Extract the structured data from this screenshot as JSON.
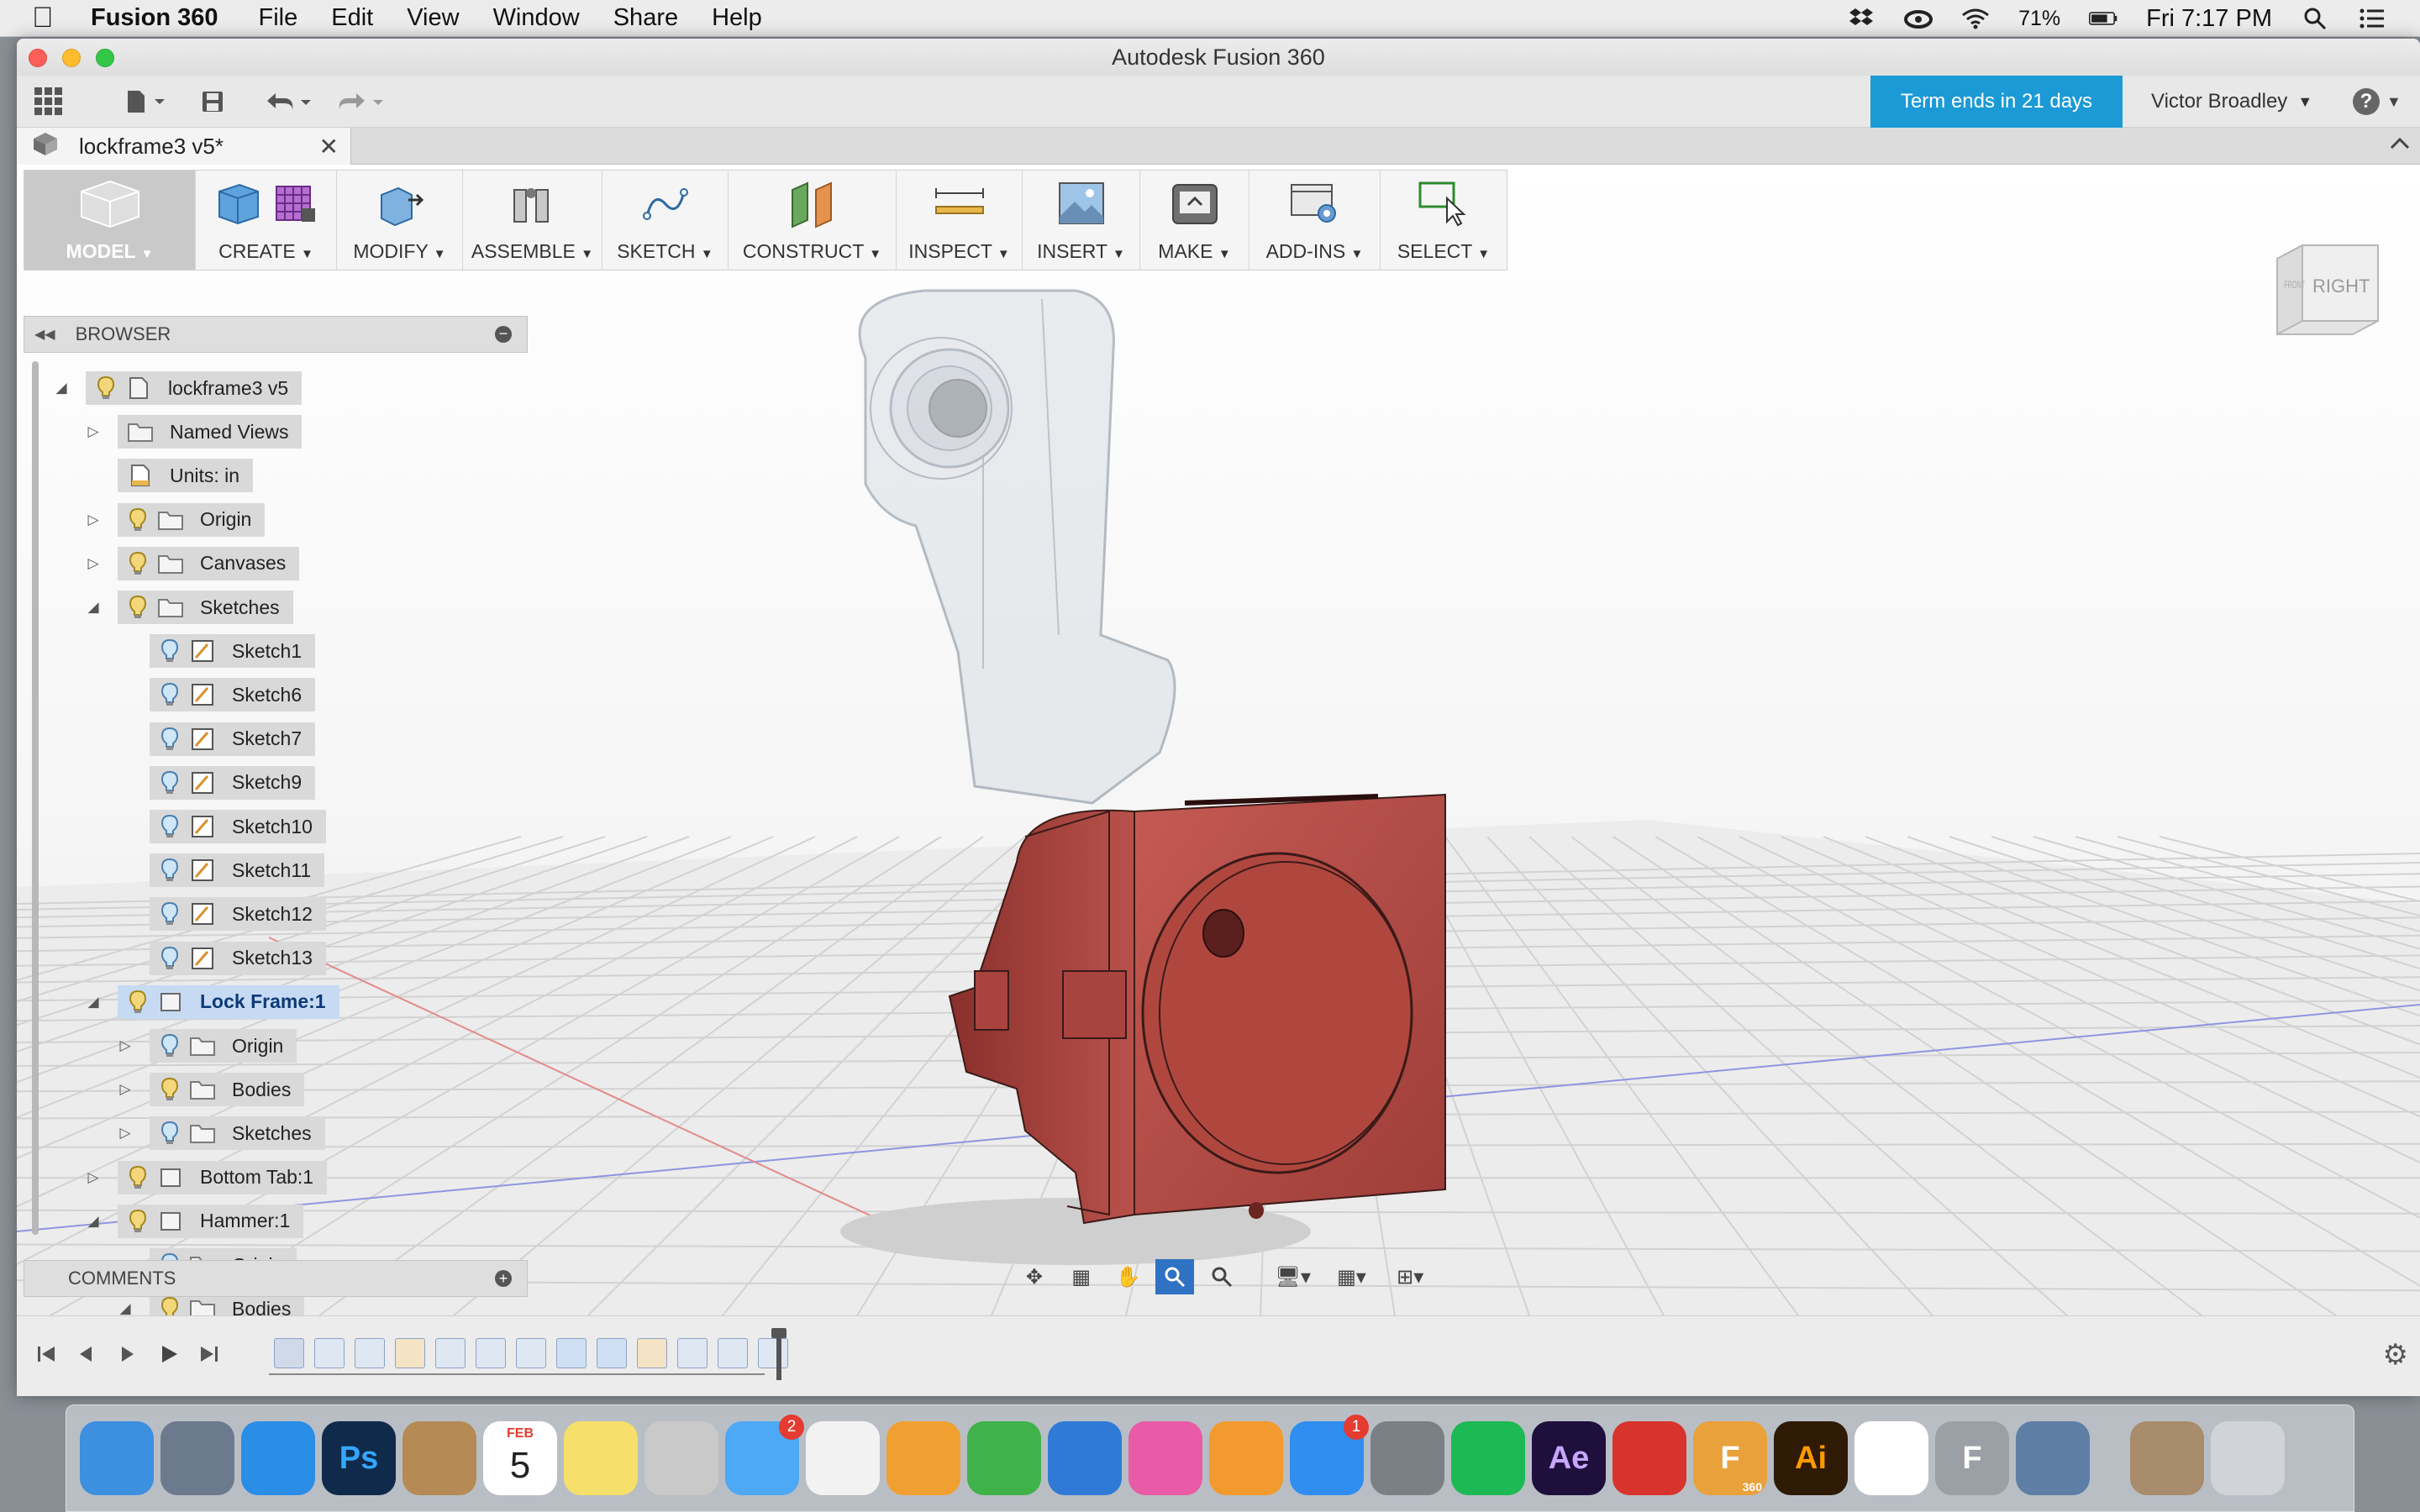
{
  "menubar": {
    "app_name": "Fusion 360",
    "items": [
      "File",
      "Edit",
      "View",
      "Window",
      "Share",
      "Help"
    ],
    "battery": "71%",
    "clock": "Fri 7:17 PM"
  },
  "window": {
    "title": "Autodesk Fusion 360",
    "term_notice": "Term ends in 21 days",
    "user_name": "Victor Broadley",
    "help_label": "?"
  },
  "document_tab": {
    "title": "lockframe3 v5*"
  },
  "toolbar": {
    "groups": [
      {
        "label": "MODEL",
        "icon": "model-workspace-icon"
      },
      {
        "label": "CREATE",
        "icon": "box-icon"
      },
      {
        "label": "MODIFY",
        "icon": "press-pull-icon"
      },
      {
        "label": "ASSEMBLE",
        "icon": "joint-icon"
      },
      {
        "label": "SKETCH",
        "icon": "spline-icon"
      },
      {
        "label": "CONSTRUCT",
        "icon": "plane-icon"
      },
      {
        "label": "INSPECT",
        "icon": "measure-icon"
      },
      {
        "label": "INSERT",
        "icon": "image-icon"
      },
      {
        "label": "MAKE",
        "icon": "3d-print-icon"
      },
      {
        "label": "ADD-INS",
        "icon": "scripts-icon"
      },
      {
        "label": "SELECT",
        "icon": "select-icon"
      }
    ]
  },
  "browser": {
    "header": "BROWSER",
    "items": [
      {
        "label": "lockframe3 v5",
        "expanded": true
      },
      {
        "label": "Named Views",
        "expanded": false
      },
      {
        "label": "Units: in"
      },
      {
        "label": "Origin",
        "expanded": false
      },
      {
        "label": "Canvases",
        "expanded": false
      },
      {
        "label": "Sketches",
        "expanded": true
      },
      {
        "label": "Sketch1"
      },
      {
        "label": "Sketch6"
      },
      {
        "label": "Sketch7"
      },
      {
        "label": "Sketch9"
      },
      {
        "label": "Sketch10"
      },
      {
        "label": "Sketch11"
      },
      {
        "label": "Sketch12"
      },
      {
        "label": "Sketch13"
      },
      {
        "label": "Lock Frame:1",
        "expanded": true,
        "selected": true
      },
      {
        "label": "Origin",
        "expanded": false
      },
      {
        "label": "Bodies",
        "expanded": false
      },
      {
        "label": "Sketches",
        "expanded": false
      },
      {
        "label": "Bottom Tab:1",
        "expanded": false
      },
      {
        "label": "Hammer:1",
        "expanded": true
      },
      {
        "label": "Origin",
        "expanded": false
      },
      {
        "label": "Bodies",
        "expanded": true
      }
    ]
  },
  "comments": {
    "header": "COMMENTS"
  },
  "viewcube": {
    "face_label": "RIGHT",
    "side_label": "FRONT"
  },
  "colors": {
    "accent_blue": "#1b9ad6",
    "part_red": "#b04a44",
    "selection_blue": "#c6dbf3"
  },
  "dock": {
    "apps": [
      {
        "name": "Finder",
        "label": ""
      },
      {
        "name": "Launchpad",
        "label": ""
      },
      {
        "name": "Safari",
        "label": ""
      },
      {
        "name": "Photoshop",
        "label": "Ps"
      },
      {
        "name": "Contacts",
        "label": ""
      },
      {
        "name": "Calendar",
        "label": "5",
        "sub": "FEB"
      },
      {
        "name": "Notes",
        "label": ""
      },
      {
        "name": "Photo Booth",
        "label": ""
      },
      {
        "name": "Messages",
        "label": "",
        "badge": "2"
      },
      {
        "name": "Photos",
        "label": ""
      },
      {
        "name": "Pages",
        "label": ""
      },
      {
        "name": "Numbers",
        "label": ""
      },
      {
        "name": "Keynote",
        "label": ""
      },
      {
        "name": "iTunes",
        "label": ""
      },
      {
        "name": "iBooks",
        "label": ""
      },
      {
        "name": "App Store",
        "label": "",
        "badge": "1"
      },
      {
        "name": "System Preferences",
        "label": ""
      },
      {
        "name": "Spotify",
        "label": ""
      },
      {
        "name": "After Effects",
        "label": "Ae"
      },
      {
        "name": "SketchUp",
        "label": ""
      },
      {
        "name": "Fusion 360",
        "label": "F",
        "sub": "360"
      },
      {
        "name": "Illustrator",
        "label": "Ai"
      },
      {
        "name": "Chrome",
        "label": ""
      },
      {
        "name": "Fontself",
        "label": "F"
      },
      {
        "name": "Preview",
        "label": ""
      },
      {
        "name": "Downloads",
        "label": ""
      },
      {
        "name": "Trash",
        "label": ""
      }
    ]
  }
}
